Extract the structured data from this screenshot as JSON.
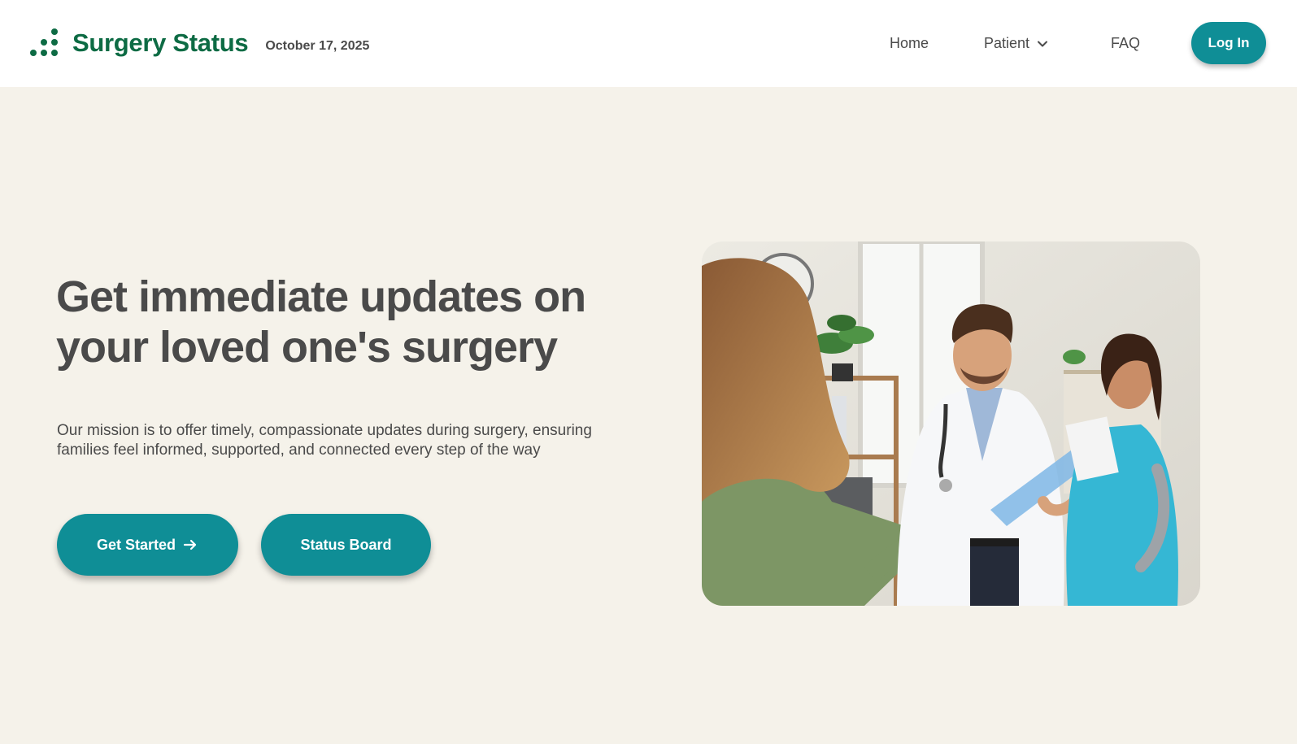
{
  "header": {
    "brand_name": "Surgery Status",
    "date": "October 17, 2025",
    "logo_icon": "dots-logo-icon",
    "nav": {
      "home": "Home",
      "patient": "Patient",
      "faq": "FAQ"
    },
    "login_label": "Log In"
  },
  "hero": {
    "title": "Get immediate updates on your loved one's surgery",
    "description": "Our mission is to offer timely, compassionate updates during surgery, ensuring families feel informed, supported, and connected every step of the way",
    "get_started_label": "Get Started",
    "status_board_label": "Status Board",
    "image_alt": "Doctor shaking hands with a family member while a nurse smiles"
  },
  "colors": {
    "brand": "#0d6b44",
    "accent": "#0f8e96",
    "background": "#f5f2ea",
    "text": "#4a4a4a"
  }
}
